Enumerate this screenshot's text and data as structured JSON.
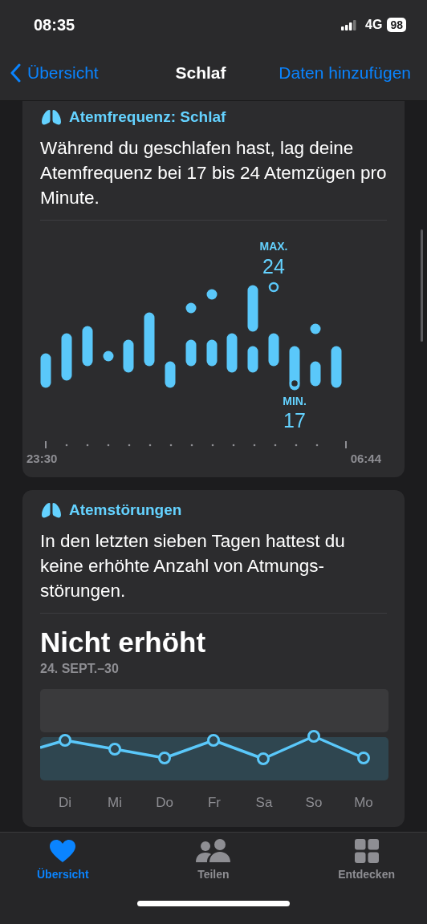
{
  "status_bar": {
    "time": "08:35",
    "network": "4G",
    "battery": "98"
  },
  "nav": {
    "back": "Übersicht",
    "title": "Schlaf",
    "action": "Daten hinzufügen"
  },
  "cards": [
    {
      "kind": "range",
      "title": "Atemfrequenz: Schlaf",
      "text": "Während du geschlafen hast, lag deine Atemfrequenz bei 17 bis 24 Atemzügen pro Minute.",
      "max_label": "MAX.",
      "max_value": "24",
      "min_label": "MIN.",
      "min_value": "17",
      "start_time": "23:30",
      "end_time": "06:44"
    },
    {
      "kind": "trend",
      "title": "Atemstörungen",
      "text": "In den letzten sieben Tagen hattest du keine erhöhte Anzahl von Atmungs-störungen.",
      "status": "Nicht erhöht",
      "date_range": "24. SEPT.–30",
      "days": [
        "Di",
        "Mi",
        "Do",
        "Fr",
        "Sa",
        "So",
        "Mo"
      ]
    }
  ],
  "tab_bar": [
    {
      "label": "Übersicht",
      "selected": true
    },
    {
      "label": "Teilen",
      "selected": false
    },
    {
      "label": "Entdecken",
      "selected": false
    }
  ]
}
